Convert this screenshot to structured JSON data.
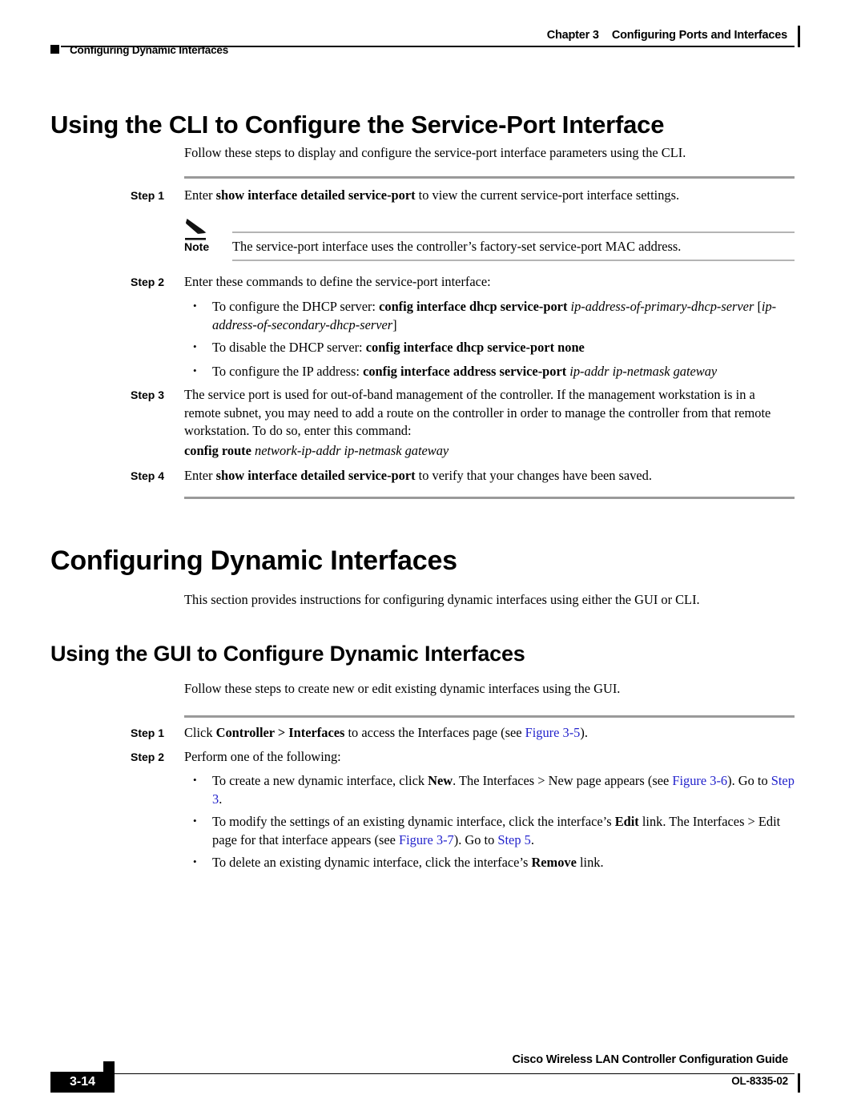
{
  "header": {
    "chapter_label": "Chapter 3",
    "chapter_title": "Configuring Ports and Interfaces",
    "section_title": "Configuring Dynamic Interfaces"
  },
  "footer": {
    "page_number": "3-14",
    "guide_title": "Cisco Wireless LAN Controller Configuration Guide",
    "doc_id": "OL-8335-02"
  },
  "colors": {
    "xref_link": "#2222cc",
    "rule_thick": "#9a9a9a",
    "rule_thin": "#b4b4b4",
    "ink": "#000000"
  },
  "section_cli": {
    "heading": "Using the CLI to Configure the Service-Port Interface",
    "intro": "Follow these steps to display and configure the service-port interface parameters using the CLI.",
    "step1": {
      "label": "Step 1",
      "text_before": "Enter ",
      "command": "show interface detailed service-port",
      "text_after": " to view the current service-port interface settings."
    },
    "note": {
      "label": "Note",
      "icon": "pencil-icon",
      "text": "The service-port interface uses the controller’s factory-set service-port MAC address."
    },
    "step2": {
      "label": "Step 2",
      "text": "Enter these commands to define the service-port interface:",
      "bullets": [
        {
          "lead": "To configure the DHCP server: ",
          "command": "config interface dhcp service-port",
          "param": " ip-address-of-primary-dhcp-server",
          "optional_open": " [",
          "optional_param": "ip-address-of-secondary-dhcp-server",
          "optional_close": "]"
        },
        {
          "lead": "To disable the DHCP server: ",
          "command": "config interface dhcp service-port none",
          "param": "",
          "optional_open": "",
          "optional_param": "",
          "optional_close": ""
        },
        {
          "lead": "To configure the IP address: ",
          "command": "config interface address service-port",
          "param": " ip-addr ip-netmask gateway",
          "optional_open": "",
          "optional_param": "",
          "optional_close": ""
        }
      ]
    },
    "step3": {
      "label": "Step 3",
      "text": "The service port is used for out-of-band management of the controller. If the management workstation is in a remote subnet, you may need to add a route on the controller in order to manage the controller from that remote workstation. To do so, enter this command:",
      "command": "config route",
      "command_params": " network-ip-addr ip-netmask gateway"
    },
    "step4": {
      "label": "Step 4",
      "text_before": "Enter ",
      "command": "show interface detailed service-port",
      "text_after": " to verify that your changes have been saved."
    }
  },
  "section_dynamic": {
    "heading": "Configuring Dynamic Interfaces",
    "intro": "This section provides instructions for configuring dynamic interfaces using either the GUI or CLI."
  },
  "section_gui": {
    "heading": "Using the GUI to Configure Dynamic Interfaces",
    "intro": "Follow these steps to create new or edit existing dynamic interfaces using the GUI.",
    "step1": {
      "label": "Step 1",
      "t1": "Click ",
      "b1": "Controller > Interfaces",
      "t2": " to access the Interfaces page (see ",
      "link1": "Figure 3-5",
      "t3": ")."
    },
    "step2": {
      "label": "Step 2",
      "text": "Perform one of the following:",
      "bullets": [
        {
          "t1": "To create a new dynamic interface, click ",
          "b1": "New",
          "t2": ". The Interfaces > New page appears (see ",
          "link1": "Figure 3-6",
          "t3": "). Go to ",
          "link2": "Step 3",
          "t4": "."
        },
        {
          "t1": "To modify the settings of an existing dynamic interface, click the interface’s ",
          "b1": "Edit",
          "t2": " link. The Interfaces > Edit page for that interface appears (see ",
          "link1": "Figure 3-7",
          "t3": "). Go to ",
          "link2": "Step 5",
          "t4": "."
        },
        {
          "t1": "To delete an existing dynamic interface, click the interface’s ",
          "b1": "Remove",
          "t2": " link.",
          "link1": "",
          "t3": "",
          "link2": "",
          "t4": ""
        }
      ]
    }
  }
}
